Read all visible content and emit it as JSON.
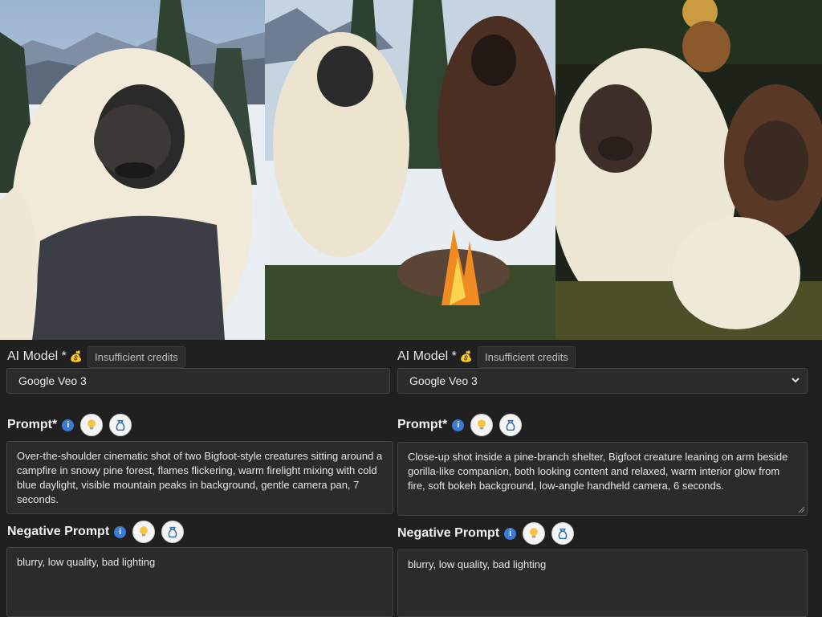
{
  "left_form": {
    "ai_model_label": "AI Model *",
    "badge": "Insufficient credits",
    "selected_model": "Google Veo 3",
    "prompt_label": "Prompt*",
    "prompt_text": "Over-the-shoulder cinematic shot of two Bigfoot-style creatures sitting around a campfire in snowy pine forest, flames flickering, warm firelight mixing with cold blue daylight, visible mountain peaks in background, gentle camera pan, 7 seconds.",
    "negative_label": "Negative Prompt",
    "negative_text": "blurry, low quality, bad lighting"
  },
  "right_form": {
    "ai_model_label": "AI Model *",
    "badge": "Insufficient credits",
    "selected_model": "Google Veo 3",
    "prompt_label": "Prompt*",
    "prompt_text": "Close-up shot inside a pine-branch shelter, Bigfoot creature leaning on arm beside gorilla-like companion, both looking content and relaxed, warm interior glow from fire, soft bokeh background, low-angle handheld camera, 6 seconds.",
    "negative_label": "Negative Prompt",
    "negative_text": "blurry, low quality, bad lighting"
  },
  "icons": {
    "info": "i",
    "moneybag": "💰",
    "lightbulb": "lightbulb-icon",
    "bag": "bag-icon"
  },
  "colors": {
    "background": "#202020",
    "field": "#2b2b2b",
    "info_blue": "#3a7bd5"
  }
}
